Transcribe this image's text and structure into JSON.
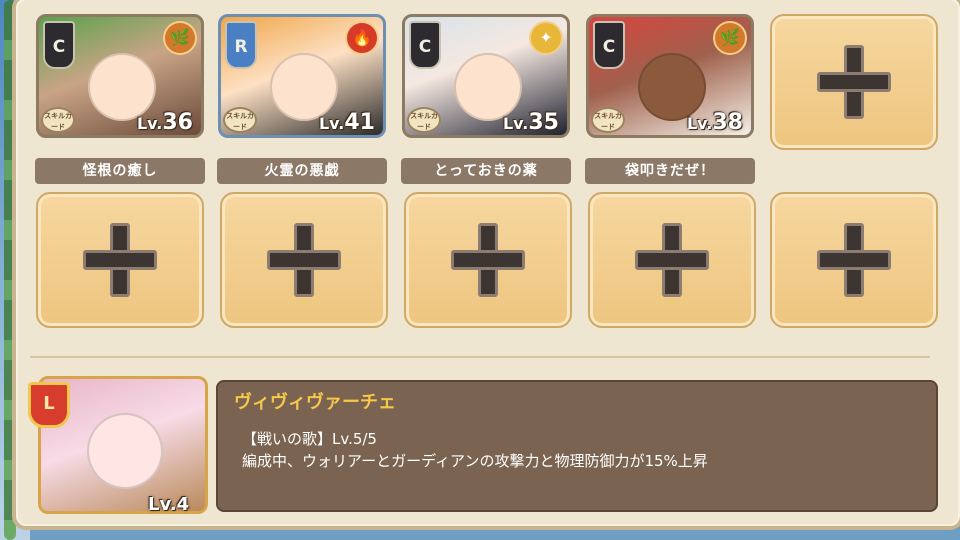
{
  "party": [
    {
      "rarity": "C",
      "element": "earth",
      "element_icon": "🌿",
      "skill_card_label": "スキルカード",
      "level_prefix": "Lv.",
      "level": "36",
      "skill_name": "怪根の癒し"
    },
    {
      "rarity": "R",
      "element": "fire",
      "element_icon": "🔥",
      "skill_card_label": "スキルカード",
      "level_prefix": "Lv.",
      "level": "41",
      "skill_name": "火霊の悪戯"
    },
    {
      "rarity": "C",
      "element": "light",
      "element_icon": "✦",
      "skill_card_label": "スキルカード",
      "level_prefix": "Lv.",
      "level": "35",
      "skill_name": "とっておきの薬"
    },
    {
      "rarity": "C",
      "element": "earth",
      "element_icon": "🌿",
      "skill_card_label": "スキルカード",
      "level_prefix": "Lv.",
      "level": "38",
      "skill_name": "袋叩きだぜ！"
    }
  ],
  "empty_slot_icon": "plus-icon",
  "leader": {
    "badge": "L",
    "level_label": "Lv.4",
    "name": "ヴィヴィヴァーチェ",
    "skill_line": "【戦いの歌】Lv.5/5",
    "description": "編成中、ウォリアーとガーディアンの攻撃力と物理防御力が15%上昇"
  },
  "colors": {
    "panel": "#efe6d2",
    "empty_slot": "#f2cf91",
    "skill_bar": "#8c7866",
    "leader_name": "#f5c84a",
    "info_box": "#7a6350"
  }
}
